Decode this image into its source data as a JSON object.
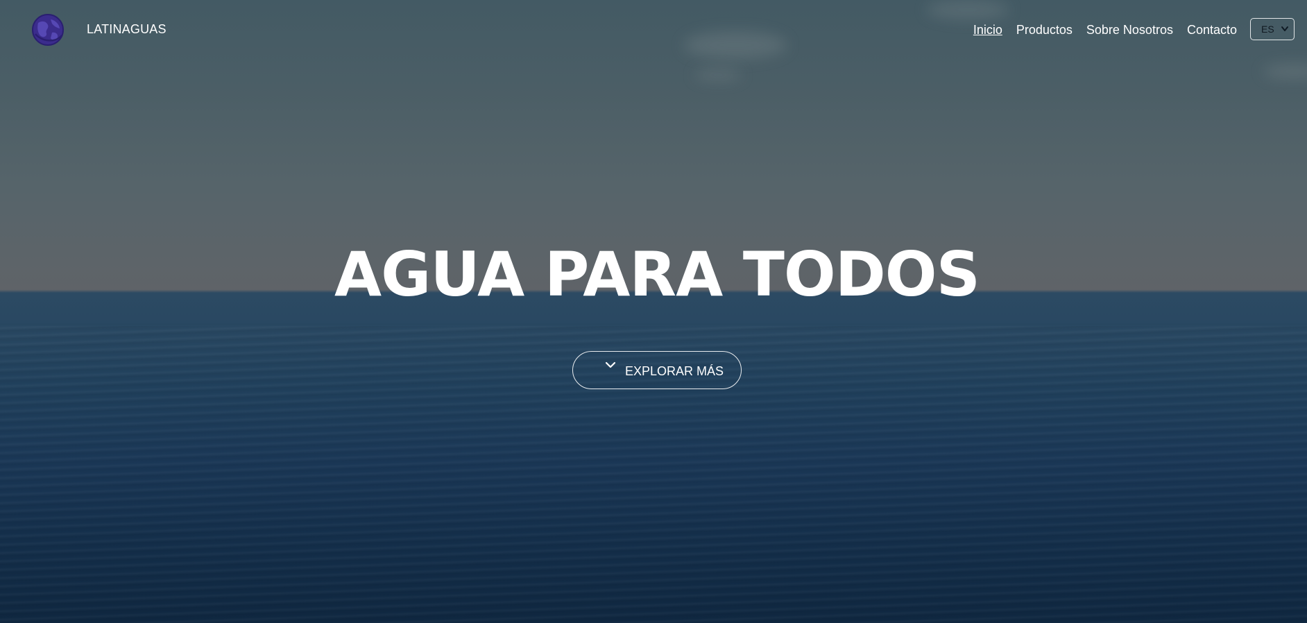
{
  "nav": {
    "brand": "LATINAGUAS",
    "logo_icon": "globe-icon",
    "links": [
      {
        "label": "Inicio",
        "active": true
      },
      {
        "label": "Productos",
        "active": false
      },
      {
        "label": "Sobre Nosotros",
        "active": false
      },
      {
        "label": "Contacto",
        "active": false
      }
    ],
    "language": {
      "selected": "ES",
      "icon": "chevron-down-icon"
    }
  },
  "hero": {
    "title": "AGUA PARA TODOS",
    "cta_label": "EXPLORAR MÁS",
    "cta_icon": "chevron-down-icon"
  },
  "colors": {
    "logo": "#3b2c8c",
    "text": "#ffffff",
    "sky": "#56646a",
    "sea": "#1a3756"
  }
}
